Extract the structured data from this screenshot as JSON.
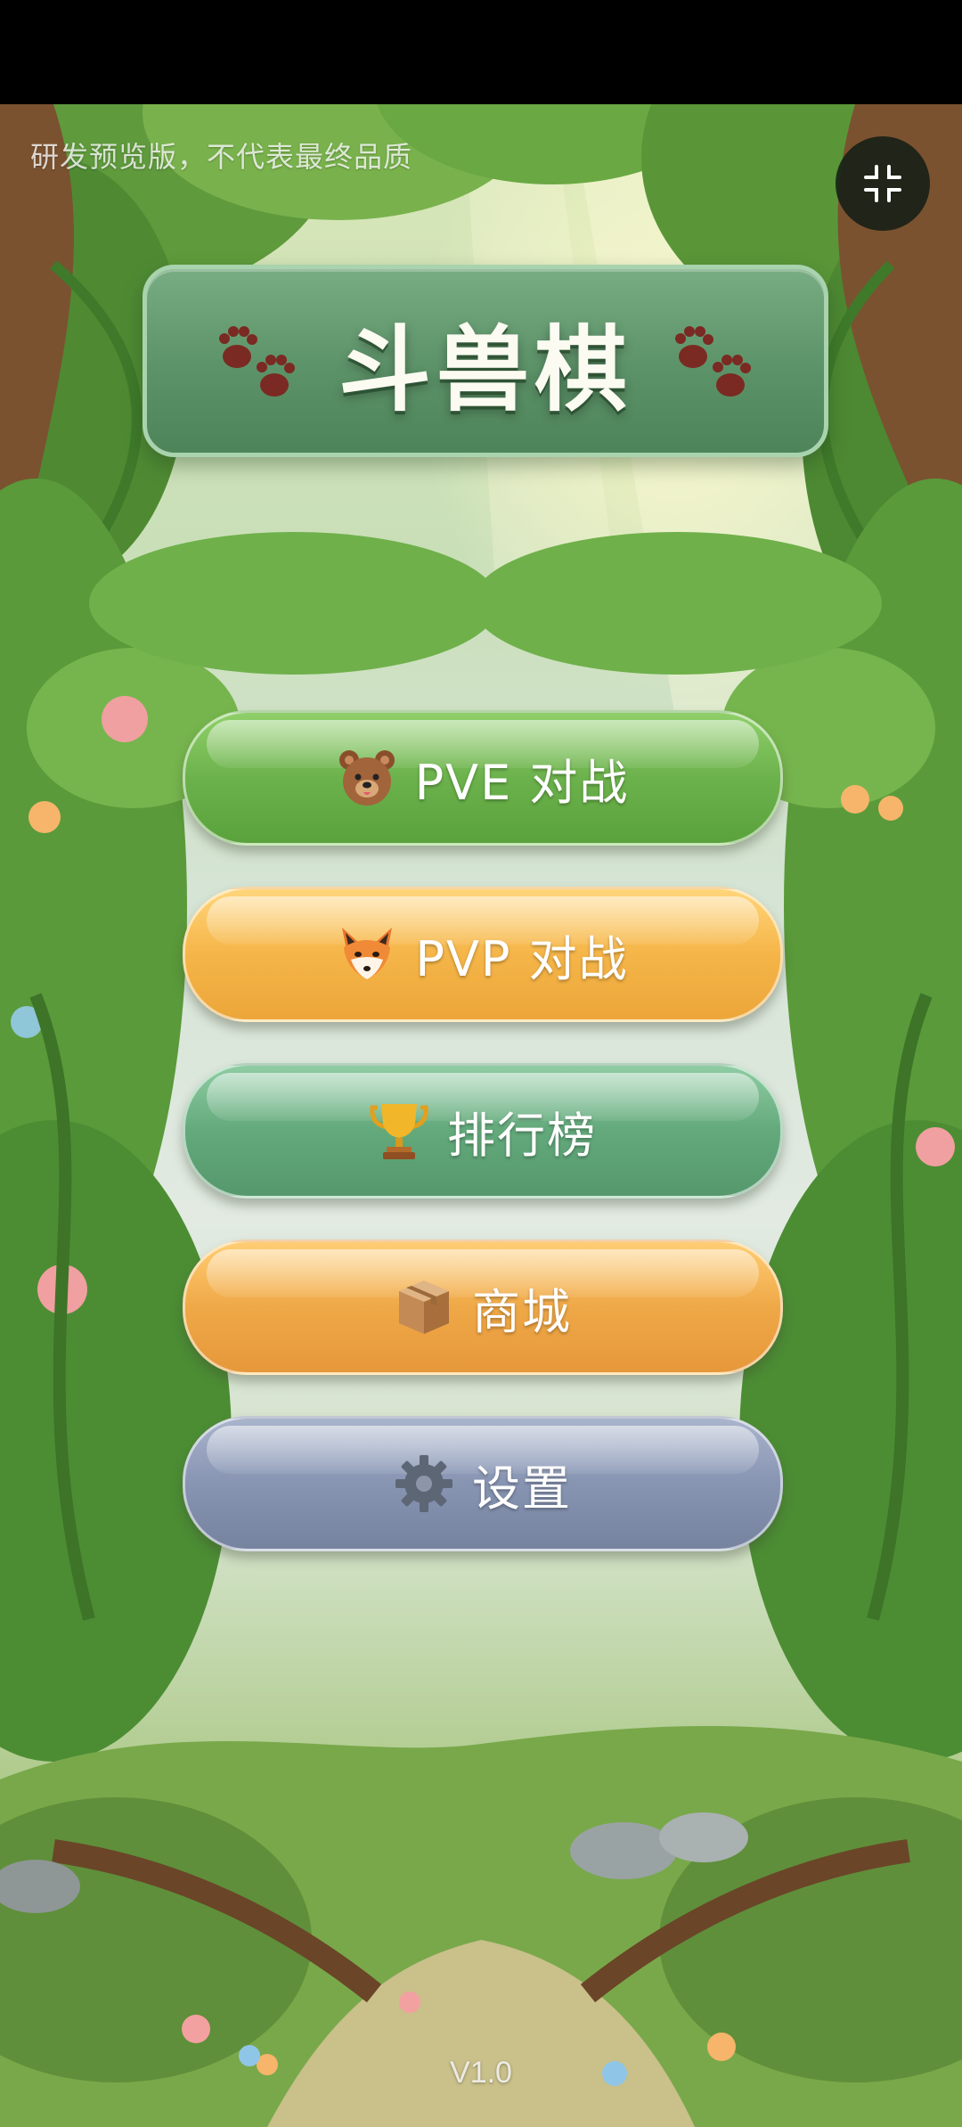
{
  "watermark": "研发预览版，不代表最终品质",
  "title": "斗兽棋",
  "menu": {
    "pve": "PVE 对战",
    "pvp": "PVP 对战",
    "leaderboard": "排行榜",
    "shop": "商城",
    "settings": "设置"
  },
  "icons": {
    "exit_fullscreen": "exit-fullscreen-icon",
    "paw": "paw-icon",
    "pve": "bear-icon",
    "pvp": "fox-icon",
    "leaderboard": "trophy-icon",
    "shop": "package-icon",
    "settings": "gear-icon"
  },
  "version": "V1.0",
  "colors": {
    "title_banner": "#5c9268",
    "pve": "#6cb24c",
    "pvp": "#f5b548",
    "leaderboard": "#63a97b",
    "shop": "#efa847",
    "settings": "#8794b2"
  }
}
